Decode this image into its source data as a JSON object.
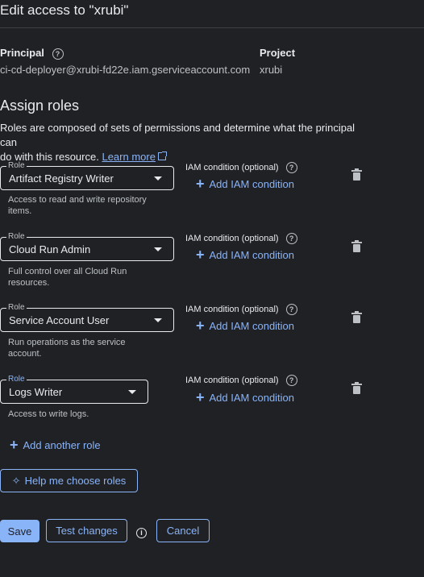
{
  "header": {
    "title": "Edit access to \"xrubi\""
  },
  "principal": {
    "label": "Principal",
    "value": "ci-cd-deployer@xrubi-fd22e.iam.gserviceaccount.com"
  },
  "project": {
    "label": "Project",
    "value": "xrubi"
  },
  "assign": {
    "heading": "Assign roles",
    "description_line1": "Roles are composed of sets of permissions and determine what the principal can",
    "description_line2": "do with this resource.",
    "learn_more": "Learn more"
  },
  "roles": [
    {
      "field_label": "Role",
      "value": "Artifact Registry Writer",
      "hint_line1": "Access to read and write repository",
      "hint_line2": "items.",
      "iam_label": "IAM condition (optional)",
      "add_condition": "Add IAM condition"
    },
    {
      "field_label": "Role",
      "value": "Cloud Run Admin",
      "hint_line1": "Full control over all Cloud Run",
      "hint_line2": "resources.",
      "iam_label": "IAM condition (optional)",
      "add_condition": "Add IAM condition"
    },
    {
      "field_label": "Role",
      "value": "Service Account User",
      "hint_line1": "Run operations as the service",
      "hint_line2": "account.",
      "iam_label": "IAM condition (optional)",
      "add_condition": "Add IAM condition"
    },
    {
      "field_label": "Role",
      "value": "Logs Writer",
      "hint_line1": "Access to write logs.",
      "hint_line2": "",
      "iam_label": "IAM condition (optional)",
      "add_condition": "Add IAM condition"
    }
  ],
  "actions": {
    "add_role": "Add another role",
    "help_choose": "Help me choose roles",
    "save": "Save",
    "test_changes": "Test changes",
    "cancel": "Cancel"
  },
  "colors": {
    "background": "#202124",
    "accent": "#8ab4f8",
    "text": "#e8eaed"
  }
}
